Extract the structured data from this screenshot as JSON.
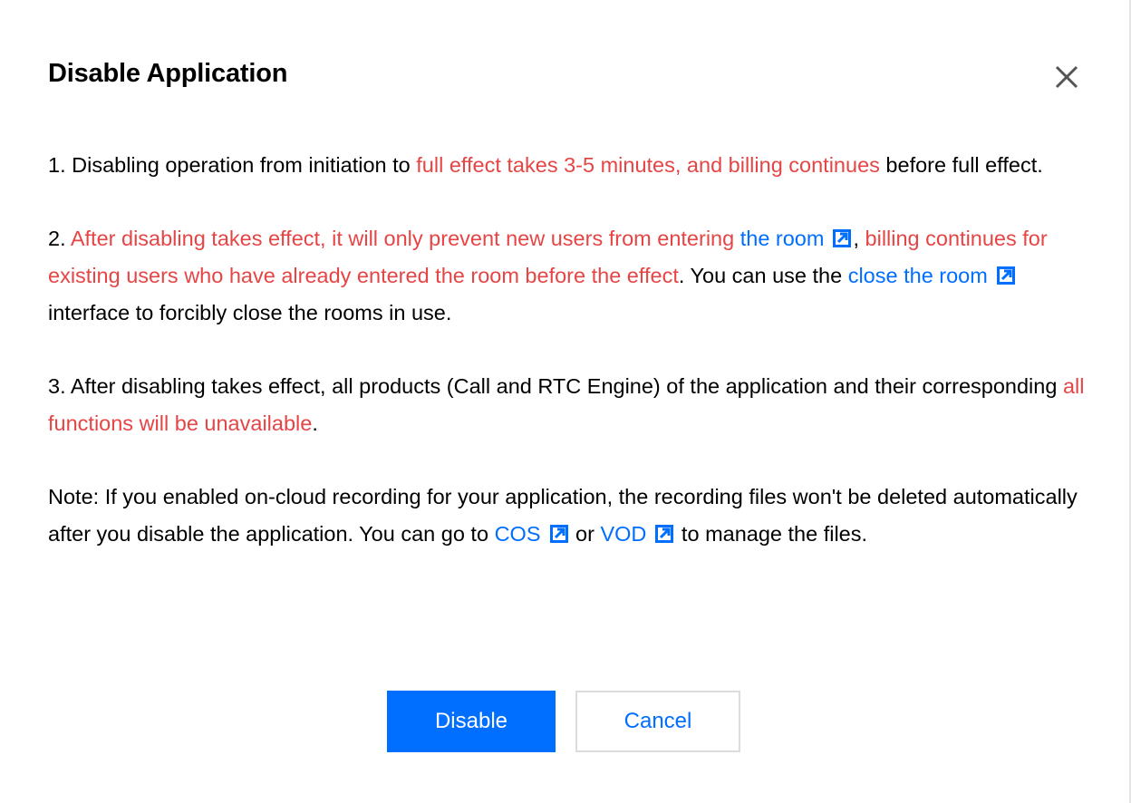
{
  "dialog": {
    "title": "Disable Application",
    "close_icon": "close-icon"
  },
  "items": {
    "p1": {
      "prefix": "1. Disabling operation from initiation to ",
      "highlight": "full effect takes 3-5 minutes, and billing continues",
      "suffix": " before full effect."
    },
    "p2": {
      "prefix": "2. ",
      "highlight_a": "After disabling takes effect, it will only prevent new users from entering ",
      "link_room": "the room",
      "comma": ", ",
      "highlight_b": "billing continues for existing users who have already entered the room before the effect",
      "mid": ". You can use the ",
      "link_close": "close the room",
      "suffix": " interface to forcibly close the rooms in use."
    },
    "p3": {
      "prefix": "3. After disabling takes effect, all products (Call and RTC Engine) of the application and their corresponding ",
      "highlight": "all functions will be unavailable",
      "suffix": "."
    },
    "note": {
      "prefix": "Note: If you enabled on-cloud recording for your application, the recording files won't be deleted automatically after you disable the application. You can go to ",
      "link_cos": "COS",
      "or": " or ",
      "link_vod": "VOD",
      "suffix": " to manage the files."
    }
  },
  "icons": {
    "external_link": "external-link-icon"
  },
  "colors": {
    "primary": "#006eff",
    "warning_text": "#e54545",
    "text": "#000000",
    "border": "#dcdcdc"
  },
  "buttons": {
    "disable_label": "Disable",
    "cancel_label": "Cancel"
  }
}
